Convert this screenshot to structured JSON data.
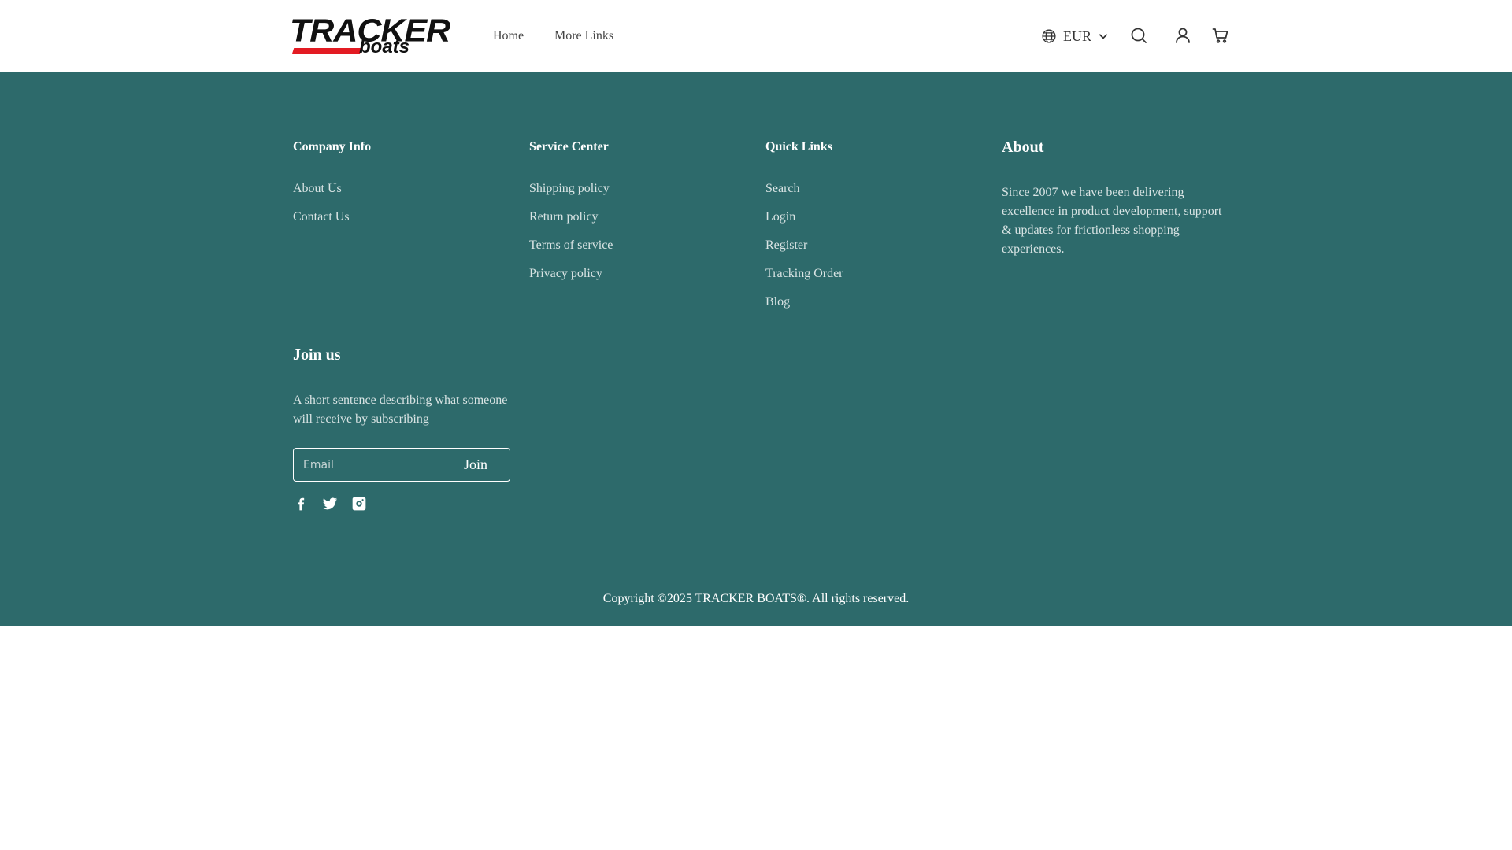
{
  "header": {
    "logo": {
      "wordmark": "TRACKER",
      "subword": "boats"
    },
    "nav": [
      {
        "label": "Home"
      },
      {
        "label": "More Links"
      }
    ],
    "currency": "EUR",
    "icons": [
      "globe-icon",
      "chevron-down-icon",
      "search-icon",
      "user-icon",
      "cart-icon"
    ]
  },
  "footer": {
    "company_info": {
      "title": "Company Info",
      "links": [
        "About Us",
        "Contact Us"
      ]
    },
    "service_center": {
      "title": "Service Center",
      "links": [
        "Shipping policy",
        "Return policy",
        "Terms of service",
        "Privacy policy"
      ]
    },
    "quick_links": {
      "title": "Quick Links",
      "links": [
        "Search",
        "Login",
        "Register",
        "Tracking Order",
        "Blog"
      ]
    },
    "about": {
      "title": "About",
      "text": "Since 2007 we have been delivering excellence in product development, support & updates for frictionless shopping experiences."
    },
    "join": {
      "title": "Join us",
      "description": "A short sentence describing what someone will receive by subscribing",
      "email_placeholder": "Email",
      "button_label": "Join"
    },
    "socials": [
      "facebook-icon",
      "twitter-icon",
      "instagram-icon"
    ],
    "copyright": "Copyright ©2025 TRACKER BOATS®. All rights reserved."
  },
  "colors": {
    "footer_bg": "#2d6a6b",
    "logo_red": "#e31b23",
    "header_bg": "#ffffff"
  }
}
